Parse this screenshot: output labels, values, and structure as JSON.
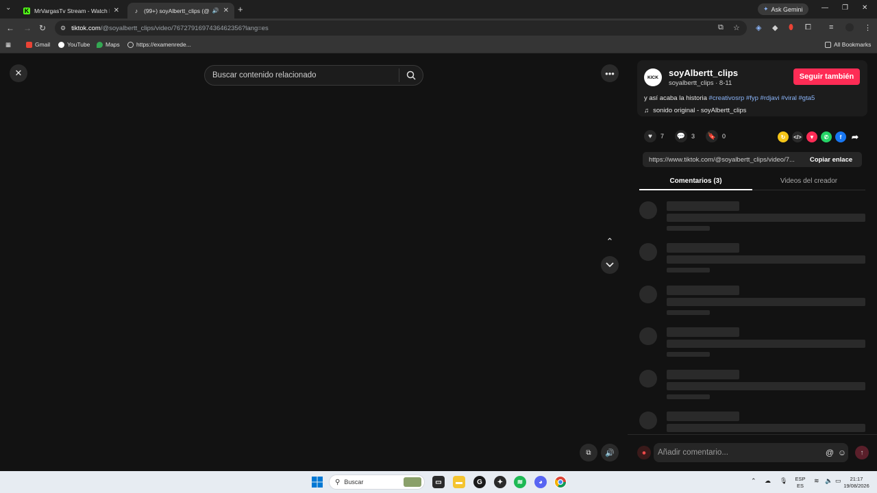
{
  "browser": {
    "tabs": [
      {
        "title": "MrVargasTv Stream - Watch Live",
        "favicon": "K"
      },
      {
        "title": "(99+) soyAlbertt_clips (@soyalbertt",
        "favicon": "♪"
      }
    ],
    "ask_gemini": "Ask Gemini",
    "url_host": "tiktok.com",
    "url_path": "/@soyalbertt_clips/video/7672791697436462356?lang=es",
    "bookmarks": [
      "Gmail",
      "YouTube",
      "Maps",
      "https://examenrede..."
    ],
    "all_bookmarks": "All Bookmarks"
  },
  "player": {
    "search_placeholder": "Buscar contenido relacionado"
  },
  "creator": {
    "avatar_text": "KICK",
    "name": "soyAlbertt_clips",
    "meta": "soyalbertt_clips · 8-11",
    "follow_label": "Seguir también",
    "caption_text": "y así acaba la historia",
    "hashtags": [
      "#creativosrp",
      "#fyp",
      "#rdjavi",
      "#viral",
      "#gta5"
    ],
    "sound": "sonido original - soyAlbertt_clips"
  },
  "stats": {
    "likes": "7",
    "comments": "3",
    "saves": "0"
  },
  "link": {
    "url": "https://www.tiktok.com/@soyalbertt_clips/video/7...",
    "copy_label": "Copiar enlace"
  },
  "panel_tabs": {
    "comments": "Comentarios (3)",
    "creator_videos": "Videos del creador"
  },
  "comment_input": {
    "placeholder": "Añadir comentario..."
  },
  "taskbar": {
    "search_label": "Buscar",
    "lang_top": "ESP",
    "lang_bottom": "ES",
    "time": "21:17",
    "date": "19/08/2026"
  },
  "colors": {
    "accent": "#fe2c55",
    "hashtag": "#8ab4f8",
    "background": "#121212"
  }
}
